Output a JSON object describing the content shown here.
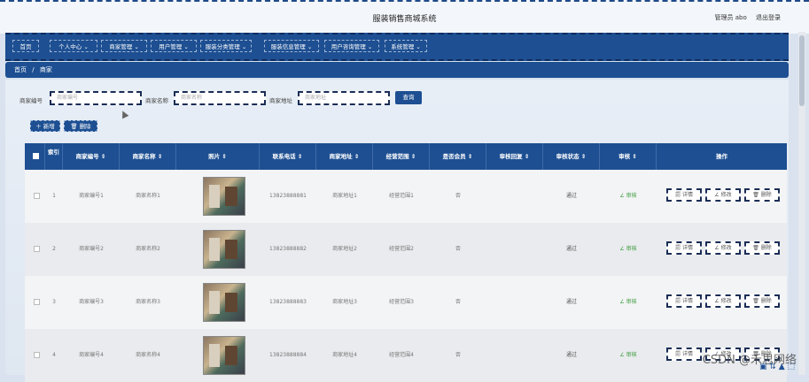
{
  "header": {
    "title": "服装销售商城系统",
    "admin_label": "管理员 abo",
    "logout": "退出登录"
  },
  "nav": [
    "首页",
    "个人中心",
    "商家管理",
    "用户管理",
    "服装分类管理",
    "服装信息管理",
    "用户咨询管理",
    "系统管理"
  ],
  "breadcrumb": {
    "home": "首页",
    "sep": "/",
    "current": "商家"
  },
  "search": {
    "label1": "商家编号",
    "label2": "商家名称",
    "label3": "商家地址",
    "placeholder1": "商家编号",
    "placeholder2": "商家名称",
    "placeholder3": "商家地址",
    "button": "查询"
  },
  "actions": {
    "add": "＋ 新增",
    "delete": "🗑 删除"
  },
  "table": {
    "headers": [
      "索引",
      "商家编号 ⇕",
      "商家名称 ⇕",
      "照片 ⇕",
      "联系电话 ⇕",
      "商家地址 ⇕",
      "经营范围 ⇕",
      "是否会员 ⇕",
      "审核回复 ⇕",
      "审核状态 ⇕",
      "审核 ⇕",
      "操作"
    ],
    "rows": [
      {
        "idx": "1",
        "code": "商家编号1",
        "name": "商家名称1",
        "phone": "13823888881",
        "addr": "商家地址1",
        "scope": "经营范围1",
        "member": "否",
        "reply": "",
        "status": "通过",
        "audit": "∠ 审核"
      },
      {
        "idx": "2",
        "code": "商家编号2",
        "name": "商家名称2",
        "phone": "13823888882",
        "addr": "商家地址2",
        "scope": "经营范围2",
        "member": "否",
        "reply": "",
        "status": "通过",
        "audit": "∠ 审核"
      },
      {
        "idx": "3",
        "code": "商家编号3",
        "name": "商家名称3",
        "phone": "13823888883",
        "addr": "商家地址3",
        "scope": "经营范围3",
        "member": "否",
        "reply": "",
        "status": "通过",
        "audit": "∠ 审核"
      },
      {
        "idx": "4",
        "code": "商家编号4",
        "name": "商家名称4",
        "phone": "13823888884",
        "addr": "商家地址4",
        "scope": "经营范围4",
        "member": "否",
        "reply": "",
        "status": "通过",
        "audit": "∠ 审核"
      }
    ],
    "ops": {
      "detail": "🗐 详情",
      "edit": "∠ 修改",
      "del": "🗑 删除"
    }
  },
  "watermark": "CSDN @禾思网络"
}
